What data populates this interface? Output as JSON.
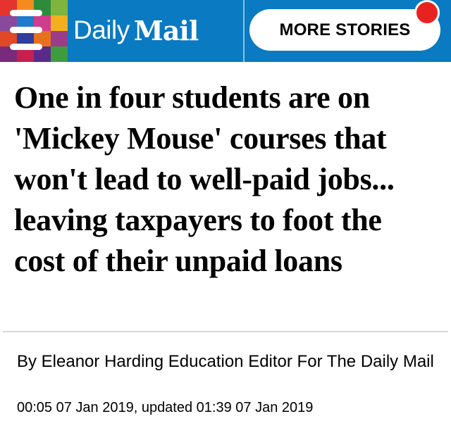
{
  "header": {
    "background_color": "#0a7ac2",
    "menu_icon": "hamburger-menu-icon",
    "logo": {
      "daily": "Daily",
      "mail": "Mail"
    },
    "more_stories_label": "MORE STORIES",
    "notification_color": "#e8231f",
    "mosaic_colors": [
      "#e5342e",
      "#f58b1f",
      "#2e8b3c",
      "#7fb43d",
      "#8a4a9c",
      "#1f7acc",
      "#cf3d8d",
      "#f2b01e",
      "#e04826",
      "#2e3e9c",
      "#e8711e",
      "#9c3b8a",
      "#7a2a7a",
      "#c81e50",
      "#5a2a8a",
      "#3e9c3e"
    ]
  },
  "article": {
    "headline": "One in four students are on 'Mickey Mouse' courses that won't lead to well-paid jobs... leaving taxpayers to foot the cost of their unpaid loans",
    "byline": "By Eleanor Harding Education Editor For The Daily Mail",
    "timestamp": "00:05 07 Jan 2019, updated 01:39 07 Jan 2019"
  }
}
